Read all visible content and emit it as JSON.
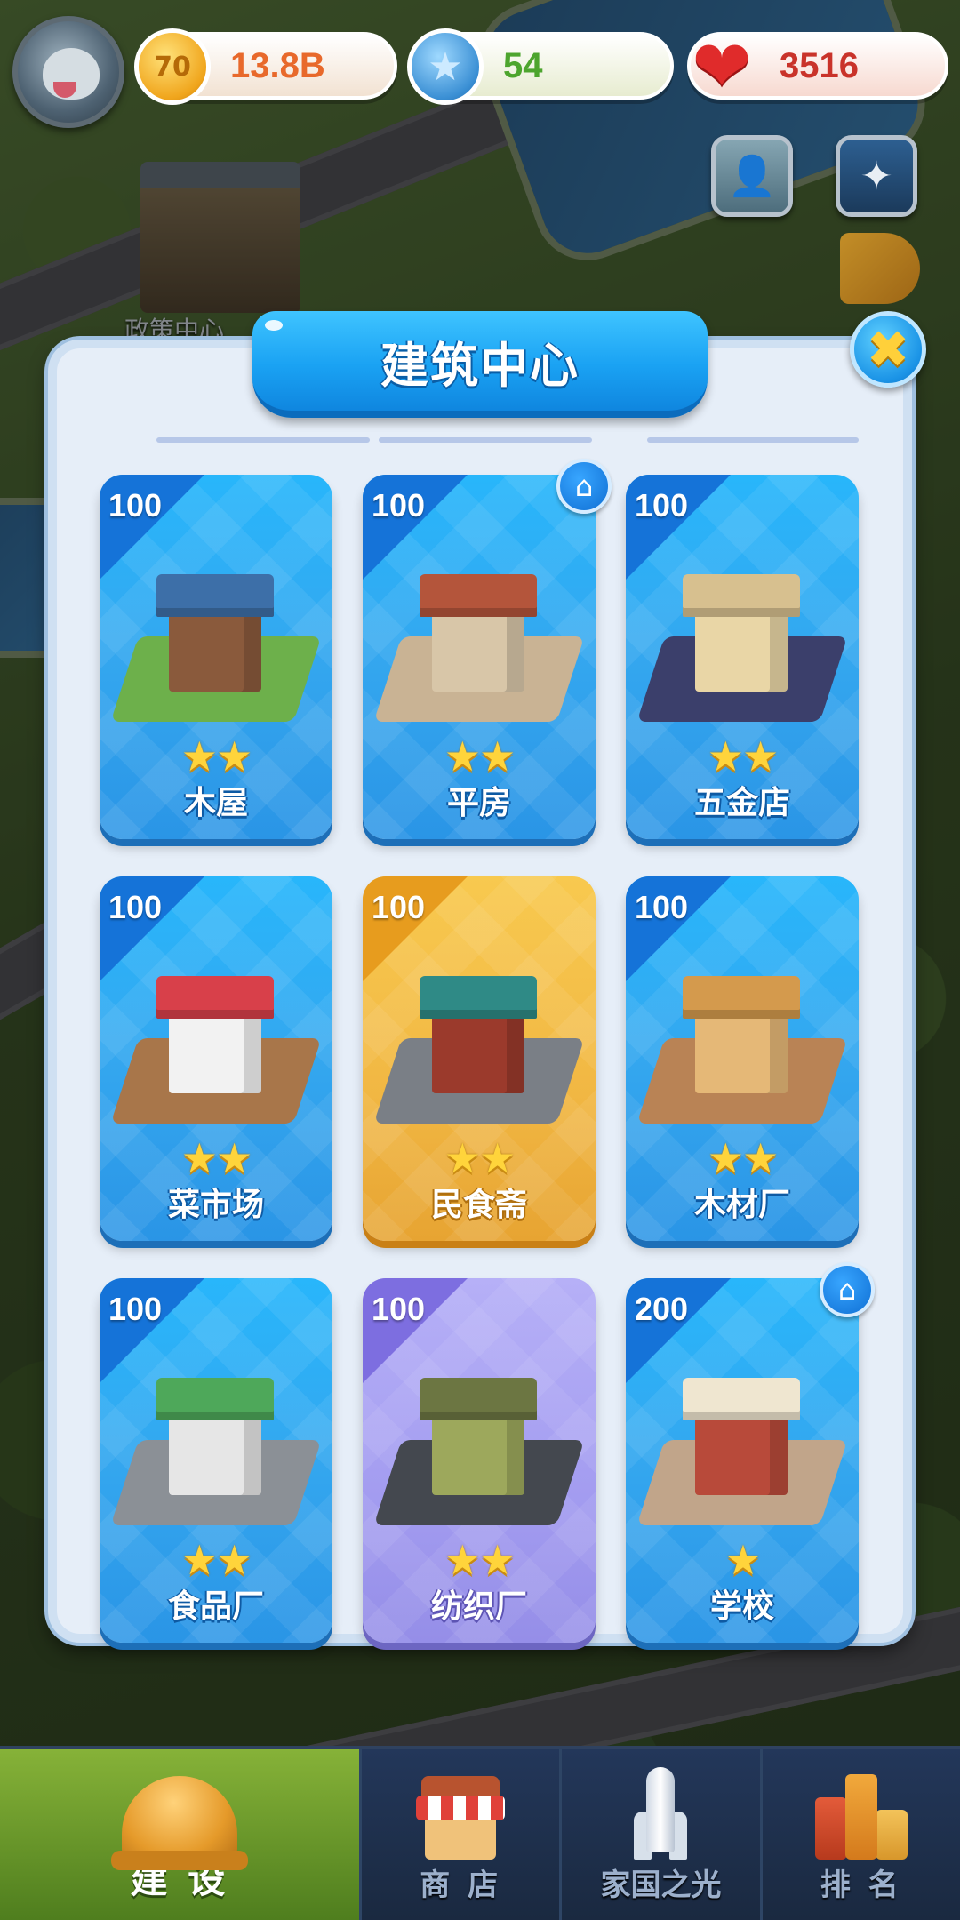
{
  "resources": {
    "coin": {
      "icon": "coin-icon",
      "glyph": "70",
      "value": "13.8B",
      "color": "#e8692b"
    },
    "star": {
      "icon": "star-coin-icon",
      "glyph": "★",
      "value": "54",
      "color": "#4da52e"
    },
    "heart": {
      "icon": "heart-icon",
      "glyph": "❤",
      "value": "3516",
      "color": "#c9332a"
    }
  },
  "world": {
    "building_label": "政策中心"
  },
  "panel": {
    "title": "建筑中心",
    "close_glyph": "✖",
    "home_glyph": "⌂",
    "star_glyph": "★",
    "buildings": [
      {
        "name": "木屋",
        "cost": "100",
        "stars": 2,
        "theme": "blue",
        "home_badge": false,
        "icon": "wooden-house-icon"
      },
      {
        "name": "平房",
        "cost": "100",
        "stars": 2,
        "theme": "blue",
        "home_badge": true,
        "icon": "bungalow-icon"
      },
      {
        "name": "五金店",
        "cost": "100",
        "stars": 2,
        "theme": "blue",
        "home_badge": false,
        "icon": "hardware-store-icon"
      },
      {
        "name": "菜市场",
        "cost": "100",
        "stars": 2,
        "theme": "blue",
        "home_badge": false,
        "icon": "vegetable-market-icon"
      },
      {
        "name": "民食斋",
        "cost": "100",
        "stars": 2,
        "theme": "gold",
        "home_badge": false,
        "icon": "restaurant-icon"
      },
      {
        "name": "木材厂",
        "cost": "100",
        "stars": 2,
        "theme": "blue",
        "home_badge": false,
        "icon": "lumber-mill-icon"
      },
      {
        "name": "食品厂",
        "cost": "100",
        "stars": 2,
        "theme": "blue",
        "home_badge": false,
        "icon": "food-factory-icon"
      },
      {
        "name": "纺织厂",
        "cost": "100",
        "stars": 2,
        "theme": "purple",
        "home_badge": false,
        "icon": "textile-mill-icon"
      },
      {
        "name": "学校",
        "cost": "200",
        "stars": 1,
        "theme": "blue",
        "home_badge": true,
        "icon": "school-icon"
      }
    ]
  },
  "bottom_nav": [
    {
      "label": "建 设",
      "icon": "hardhat-icon",
      "active": true
    },
    {
      "label": "商 店",
      "icon": "shop-icon",
      "active": false
    },
    {
      "label": "家国之光",
      "icon": "rocket-icon",
      "active": false
    },
    {
      "label": "排 名",
      "icon": "ranking-icon",
      "active": false
    }
  ]
}
